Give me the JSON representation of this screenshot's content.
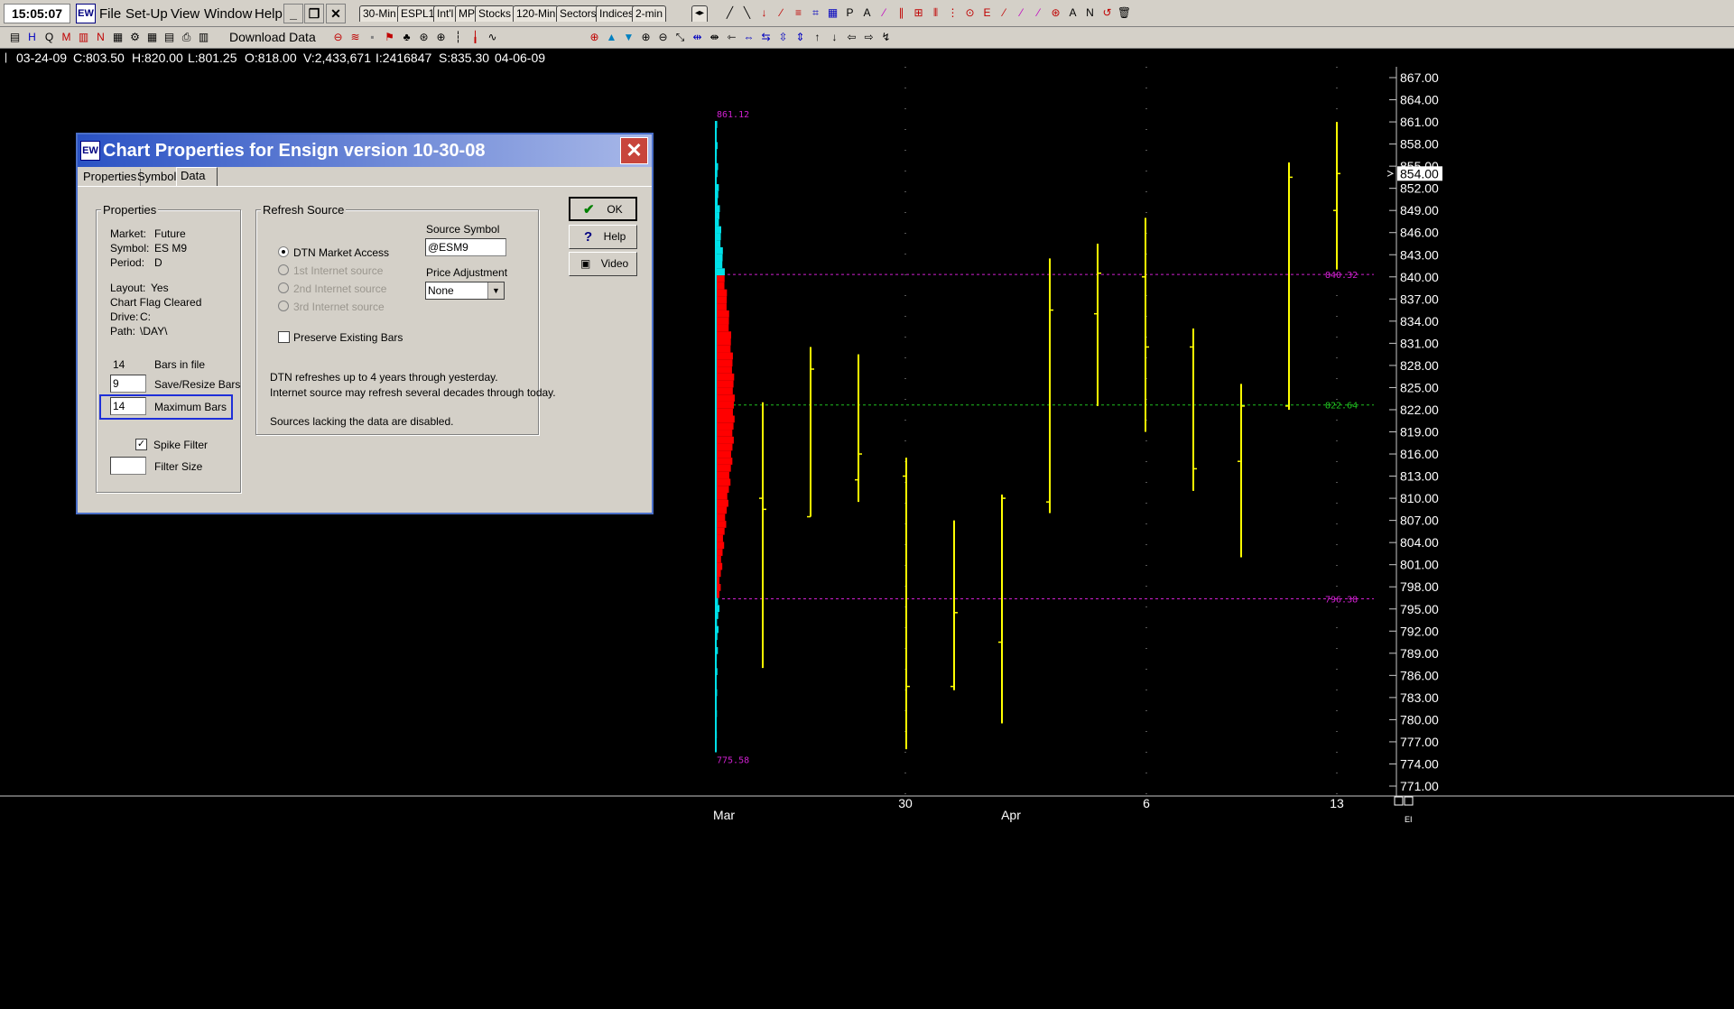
{
  "menubar": {
    "clock": "15:05:07",
    "logo": "EW",
    "menu": [
      "File",
      "Set-Up",
      "View",
      "Window",
      "Help"
    ],
    "tabs": [
      "30-Min",
      "ESPL1",
      "Int'l",
      "MP",
      "Stocks",
      "120-Min",
      "Sectors",
      "Indices",
      "2-min"
    ]
  },
  "toolbar2": {
    "download_label": "Download Data"
  },
  "status": {
    "date": "03-24-09",
    "close": "C:803.50",
    "high": "H:820.00",
    "low": "L:801.25",
    "open": "O:818.00",
    "volume": "V:2,433,671",
    "interest": "I:2416847",
    "settle": "S:835.30",
    "date2": "04-06-09"
  },
  "dialog": {
    "title": "Chart Properties for Ensign version 10-30-08",
    "title_icon": "EW",
    "close": "✕",
    "tabs": [
      "Properties",
      "Symbol",
      "Data"
    ],
    "properties": {
      "title": "Properties",
      "market_label": "Market:",
      "market": "Future",
      "symbol_label": "Symbol:",
      "symbol": "ES M9",
      "period_label": "Period:",
      "period": "D",
      "layout_label": "Layout:",
      "layout": "Yes",
      "chart_flag": "Chart Flag Cleared",
      "drive_label": "Drive:",
      "drive": "C:",
      "path_label": "Path:",
      "path": "\\DAY\\",
      "bars_in_file": "14",
      "bars_in_file_label": "Bars in file",
      "save_resize_value": "9",
      "save_resize_label": "Save/Resize Bars",
      "max_bars_value": "14",
      "max_bars_label": "Maximum Bars",
      "spike_filter_label": "Spike Filter",
      "spike_filter_checked": true,
      "filter_size_value": "",
      "filter_size_label": "Filter Size"
    },
    "refresh": {
      "title": "Refresh Source",
      "options": [
        "DTN Market Access",
        "1st Internet source",
        "2nd Internet source",
        "3rd Internet source"
      ],
      "preserve_label": "Preserve Existing Bars",
      "source_symbol_label": "Source Symbol",
      "source_symbol": "@ESM9",
      "price_adj_label": "Price Adjustment",
      "price_adj": "None",
      "note1": "DTN refreshes up to 4 years through yesterday.",
      "note2": "Internet source may refresh several decades through today.",
      "note3": "Sources lacking the data are disabled."
    },
    "buttons": {
      "ok": "OK",
      "help": "Help",
      "video": "Video"
    }
  },
  "chart_data": {
    "type": "bar",
    "ohlc": [
      {
        "o": 810.0,
        "h": 823.0,
        "l": 787.0,
        "c": 808.5
      },
      {
        "o": 807.5,
        "h": 830.5,
        "l": 807.5,
        "c": 827.5
      },
      {
        "o": 812.5,
        "h": 829.5,
        "l": 809.5,
        "c": 816.0
      },
      {
        "o": 813.0,
        "h": 815.5,
        "l": 776.0,
        "c": 784.5
      },
      {
        "o": 784.5,
        "h": 807.0,
        "l": 784.0,
        "c": 794.5
      },
      {
        "o": 790.5,
        "h": 810.5,
        "l": 779.5,
        "c": 810.0
      },
      {
        "o": 809.5,
        "h": 842.5,
        "l": 808.0,
        "c": 835.5
      },
      {
        "o": 835.0,
        "h": 844.5,
        "l": 822.5,
        "c": 840.5
      },
      {
        "o": 840.0,
        "h": 848.0,
        "l": 819.0,
        "c": 830.5
      },
      {
        "o": 830.5,
        "h": 833.0,
        "l": 811.0,
        "c": 814.0
      },
      {
        "o": 815.0,
        "h": 825.5,
        "l": 802.0,
        "c": 822.5
      },
      {
        "o": 822.5,
        "h": 855.5,
        "l": 822.0,
        "c": 853.5
      },
      {
        "o": 849.0,
        "h": 861.0,
        "l": 841.0,
        "c": 854.0
      }
    ],
    "price_ticks": [
      "867.00",
      "864.00",
      "861.00",
      "858.00",
      "855.00",
      "852.00",
      "849.00",
      "846.00",
      "843.00",
      "840.00",
      "837.00",
      "834.00",
      "831.00",
      "828.00",
      "825.00",
      "822.00",
      "819.00",
      "816.00",
      "813.00",
      "810.00",
      "807.00",
      "804.00",
      "801.00",
      "798.00",
      "795.00",
      "792.00",
      "789.00",
      "786.00",
      "783.00",
      "780.00",
      "777.00",
      "774.00",
      "771.00"
    ],
    "last_price": "854.00",
    "profile_high": "861.12",
    "profile_low": "775.58",
    "levels": [
      {
        "label": "840.32",
        "value": 840.32,
        "color": "#d020d0"
      },
      {
        "label": "822.64",
        "value": 822.64,
        "color": "#20c020"
      },
      {
        "label": "796.38",
        "value": 796.38,
        "color": "#d020d0"
      }
    ],
    "date_labels": [
      "30",
      "6",
      "13"
    ],
    "month_labels": [
      "Mar",
      "Apr"
    ],
    "corner_label": "EI",
    "ylim": [
      771.0,
      867.0
    ]
  }
}
